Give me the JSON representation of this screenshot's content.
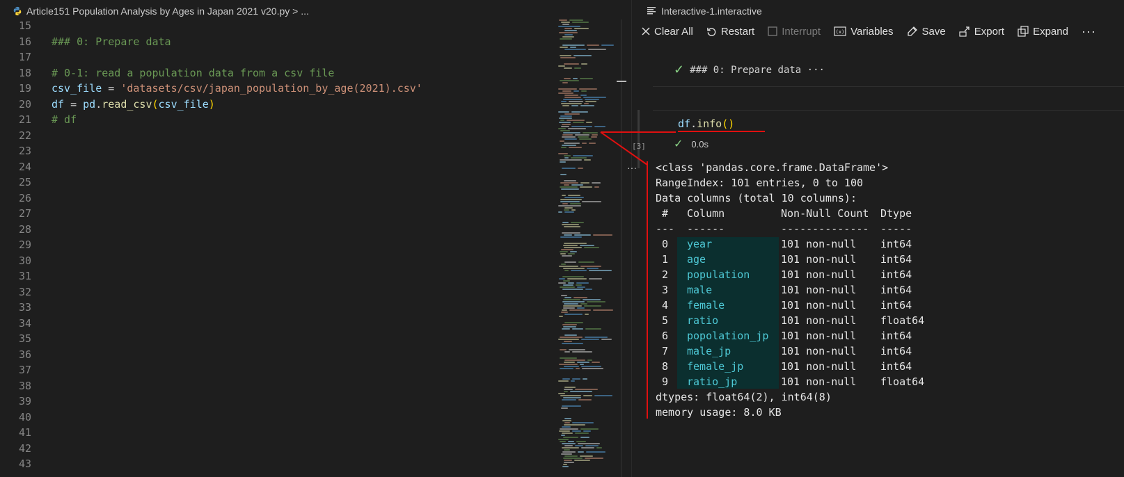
{
  "editor": {
    "breadcrumb": "Article151 Population Analysis by Ages in Japan 2021 v20.py > ...",
    "lines": [
      {
        "n": "15",
        "t": ""
      },
      {
        "n": "16",
        "t": "### 0: Prepare data"
      },
      {
        "n": "17",
        "t": ""
      },
      {
        "n": "18",
        "t": "# 0-1: read a population data from a csv file"
      },
      {
        "n": "19",
        "t": "csv_file = 'datasets/csv/japan_population_by_age(2021).csv'"
      },
      {
        "n": "20",
        "t": "df = pd.read_csv(csv_file)"
      },
      {
        "n": "21",
        "t": "# df"
      },
      {
        "n": "22",
        "t": ""
      },
      {
        "n": "23",
        "t": ""
      },
      {
        "n": "24",
        "t": ""
      },
      {
        "n": "25",
        "t": ""
      },
      {
        "n": "26",
        "t": ""
      },
      {
        "n": "27",
        "t": ""
      },
      {
        "n": "28",
        "t": ""
      },
      {
        "n": "29",
        "t": ""
      },
      {
        "n": "30",
        "t": ""
      },
      {
        "n": "31",
        "t": ""
      },
      {
        "n": "32",
        "t": ""
      },
      {
        "n": "33",
        "t": ""
      },
      {
        "n": "34",
        "t": ""
      },
      {
        "n": "35",
        "t": ""
      },
      {
        "n": "36",
        "t": ""
      },
      {
        "n": "37",
        "t": ""
      },
      {
        "n": "38",
        "t": ""
      },
      {
        "n": "39",
        "t": ""
      },
      {
        "n": "40",
        "t": ""
      },
      {
        "n": "41",
        "t": ""
      },
      {
        "n": "42",
        "t": ""
      },
      {
        "n": "43",
        "t": ""
      }
    ],
    "code": {
      "l16": "### 0: Prepare data",
      "l18": "# 0-1: read a population data from a csv file",
      "l19_var": "csv_file",
      "l19_eq": " = ",
      "l19_str": "'datasets/csv/japan_population_by_age(2021).csv'",
      "l20_var": "df",
      "l20_eq": " = ",
      "l20_mod": "pd",
      "l20_dot": ".",
      "l20_fn": "read_csv",
      "l20_open": "(",
      "l20_arg": "csv_file",
      "l20_close": ")",
      "l21": "# df"
    }
  },
  "interactive": {
    "tab_title": "Interactive-1.interactive",
    "toolbar": {
      "clear_all": "Clear All",
      "restart": "Restart",
      "interrupt": "Interrupt",
      "variables": "Variables",
      "save": "Save",
      "export": "Export",
      "expand": "Expand",
      "more": "···"
    },
    "md_cell": "### 0: Prepare data ···",
    "code_cell": {
      "code_obj": "df",
      "code_dot": ".",
      "code_fn": "info",
      "code_parens": "()",
      "exec_count": "[3]",
      "exec_time": "0.0s"
    },
    "output_dots": "···",
    "output": {
      "class_line": "<class 'pandas.core.frame.DataFrame'>",
      "range_index": "RangeIndex: 101 entries, 0 to 100",
      "data_columns": "Data columns (total 10 columns):",
      "header": {
        "num": "#",
        "column": "Column",
        "count": "Non-Null Count",
        "dtype": "Dtype"
      },
      "dashes": {
        "num": "---",
        "column": "------",
        "count": "--------------",
        "dtype": "-----"
      },
      "rows": [
        {
          "i": "0",
          "name": "year",
          "count": "101 non-null",
          "dtype": "int64"
        },
        {
          "i": "1",
          "name": "age",
          "count": "101 non-null",
          "dtype": "int64"
        },
        {
          "i": "2",
          "name": "population",
          "count": "101 non-null",
          "dtype": "int64"
        },
        {
          "i": "3",
          "name": "male",
          "count": "101 non-null",
          "dtype": "int64"
        },
        {
          "i": "4",
          "name": "female",
          "count": "101 non-null",
          "dtype": "int64"
        },
        {
          "i": "5",
          "name": "ratio",
          "count": "101 non-null",
          "dtype": "float64"
        },
        {
          "i": "6",
          "name": "popolation_jp",
          "count": "101 non-null",
          "dtype": "int64"
        },
        {
          "i": "7",
          "name": "male_jp",
          "count": "101 non-null",
          "dtype": "int64"
        },
        {
          "i": "8",
          "name": "female_jp",
          "count": "101 non-null",
          "dtype": "int64"
        },
        {
          "i": "9",
          "name": "ratio_jp",
          "count": "101 non-null",
          "dtype": "float64"
        }
      ],
      "dtypes": "dtypes: float64(2), int64(8)",
      "memory": "memory usage: 8.0 KB"
    }
  },
  "colors": {
    "annotation": "#e01010",
    "success": "#89d185",
    "column_highlight": "#0b2f2f"
  }
}
